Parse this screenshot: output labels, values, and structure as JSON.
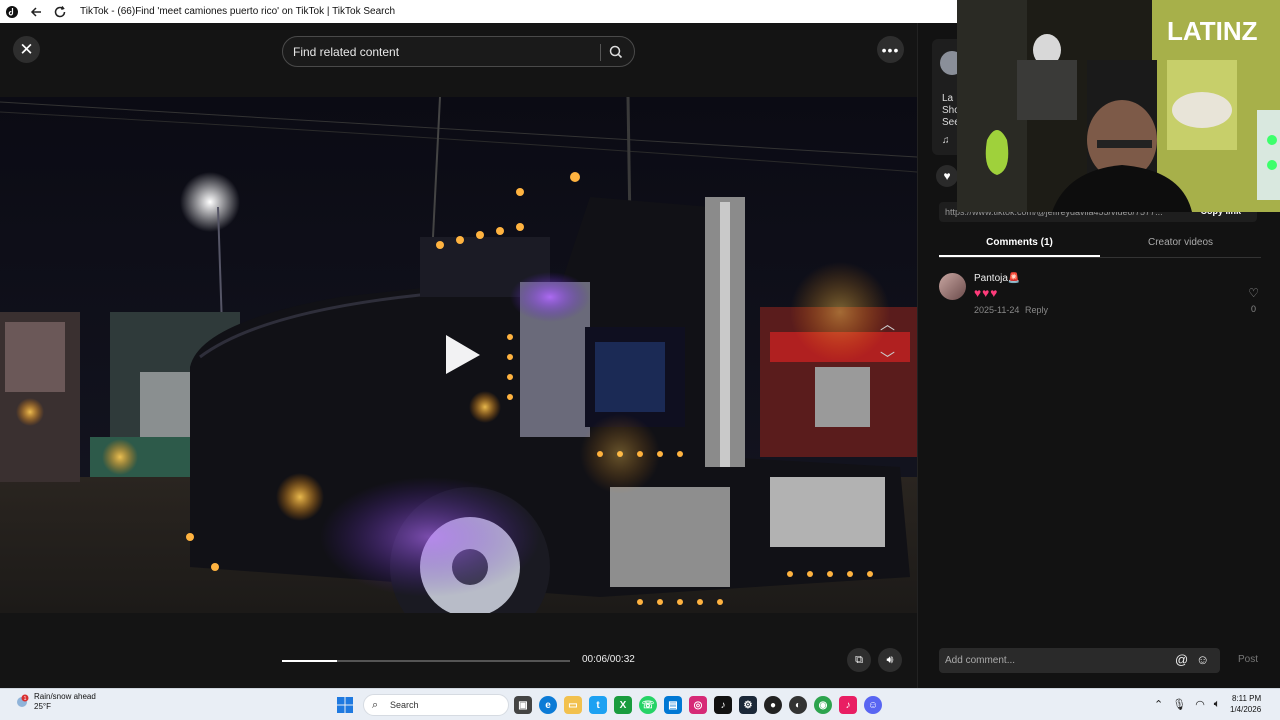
{
  "browser": {
    "title": "TikTok - (66)Find 'meet camiones puerto rico' on TikTok | TikTok Search"
  },
  "search": {
    "placeholder": "Find related content"
  },
  "player": {
    "time": "00:06/00:32",
    "progress": 0.19
  },
  "panel": {
    "author_initial_lines": [
      "La",
      "Sho",
      "See"
    ],
    "link_text": "https://www.tiktok.com/@jeffreydavila455/video/7577...",
    "copy_link": "Copy link",
    "tabs": [
      "Comments (1)",
      "Creator videos"
    ]
  },
  "comments": [
    {
      "user": "Pantoja🚨",
      "text": "♥♥♥",
      "date": "2025-11-24",
      "reply": "Reply",
      "likes": "0"
    }
  ],
  "comment_input": {
    "placeholder": "Add comment...",
    "post": "Post"
  },
  "taskbar": {
    "weather_title": "Rain/snow ahead",
    "weather_temp": "25°F",
    "search_label": "Search",
    "time": "8:11 PM",
    "date": "1/4/2026"
  },
  "webcam": {
    "overlay_text": "LATINZ"
  }
}
